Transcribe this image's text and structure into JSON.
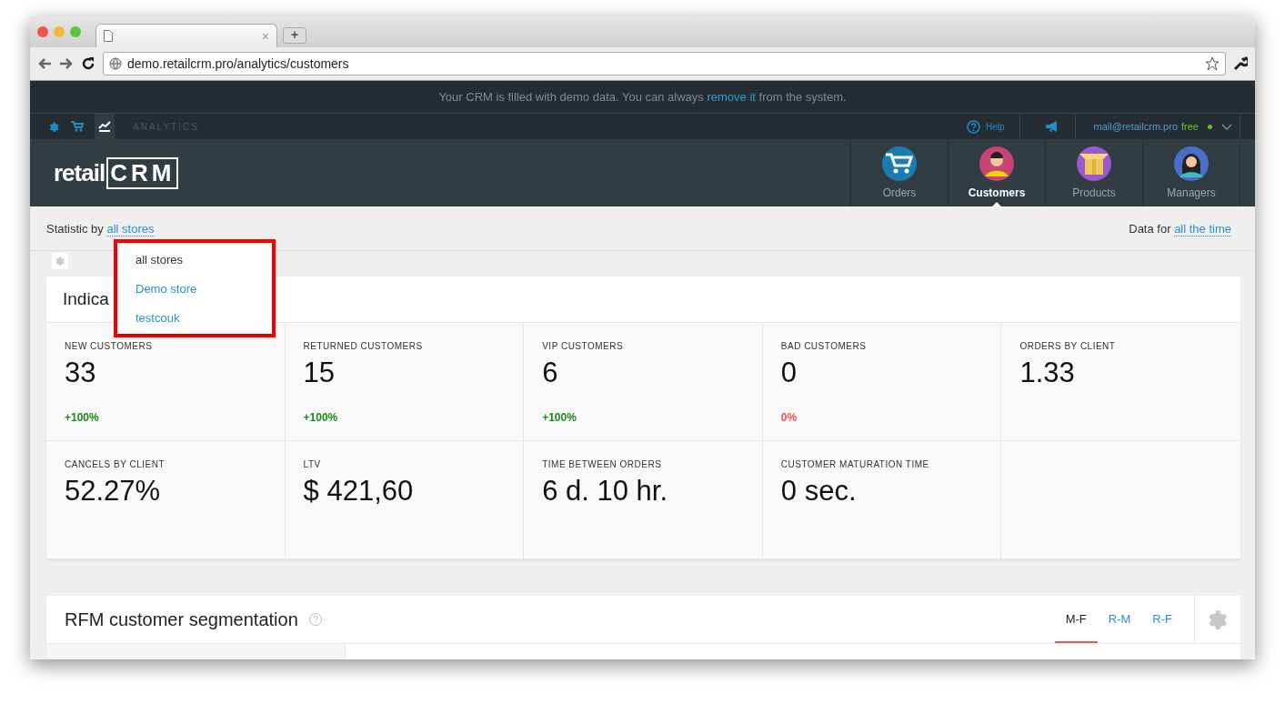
{
  "browser": {
    "tab_close": "×",
    "new_tab": "+",
    "url": "demo.retailcrm.pro/analytics/customers"
  },
  "banner": {
    "before": "Your CRM is filled with demo data. You can always ",
    "link": "remove it",
    "after": " from the system."
  },
  "subnav": {
    "section": "ANALYTICS",
    "help": "Help",
    "email": "mail@retailcrm.pro",
    "plan": "free"
  },
  "logo": {
    "text": "retail",
    "mark": "CRM"
  },
  "nav": [
    {
      "label": "Orders",
      "kind": "cart",
      "selected": false
    },
    {
      "label": "Customers",
      "kind": "man",
      "selected": true
    },
    {
      "label": "Products",
      "kind": "box",
      "selected": false
    },
    {
      "label": "Managers",
      "kind": "woman",
      "selected": false
    }
  ],
  "filter": {
    "label": "Statistic by",
    "value": "all stores",
    "period_label": "Data for",
    "period": "all the time"
  },
  "store_menu": [
    {
      "label": "all stores",
      "selected": true
    },
    {
      "label": "Demo store",
      "selected": false
    },
    {
      "label": "testcouk",
      "selected": false
    }
  ],
  "indicators": {
    "title": "Indica",
    "metrics": [
      {
        "label": "NEW CUSTOMERS",
        "value": "33",
        "change": "+100%",
        "kind": "positive"
      },
      {
        "label": "RETURNED CUSTOMERS",
        "value": "15",
        "change": "+100%",
        "kind": "positive"
      },
      {
        "label": "VIP CUSTOMERS",
        "value": "6",
        "change": "+100%",
        "kind": "positive"
      },
      {
        "label": "BAD CUSTOMERS",
        "value": "0",
        "change": "0%",
        "kind": "negative"
      },
      {
        "label": "ORDERS BY CLIENT",
        "value": "1.33"
      },
      {
        "label": "CANCELS BY CLIENT",
        "value": "52.27%"
      },
      {
        "label": "LTV",
        "value": "$ 421,60"
      },
      {
        "label": "TIME BETWEEN ORDERS",
        "value": "6 d. 10 hr."
      },
      {
        "label": "CUSTOMER MATURATION TIME",
        "value": "0 sec."
      }
    ]
  },
  "rfm": {
    "title": "RFM customer segmentation",
    "tabs": [
      {
        "label": "M-F",
        "selected": true
      },
      {
        "label": "R-M",
        "selected": false
      },
      {
        "label": "R-F",
        "selected": false
      }
    ]
  }
}
